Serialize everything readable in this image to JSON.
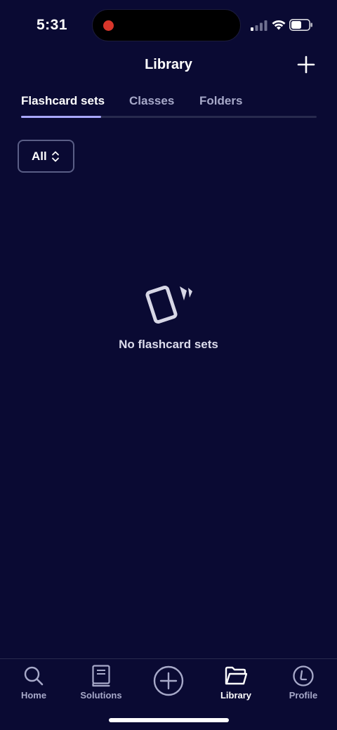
{
  "status_bar": {
    "time": "5:31"
  },
  "header": {
    "title": "Library",
    "add_icon": "plus-icon"
  },
  "tabs": [
    {
      "label": "Flashcard sets",
      "active": true
    },
    {
      "label": "Classes",
      "active": false
    },
    {
      "label": "Folders",
      "active": false
    }
  ],
  "filter": {
    "label": "All",
    "icon": "chevron-updown-icon"
  },
  "empty_state": {
    "icon": "flashcards-icon",
    "text": "No flashcard sets"
  },
  "bottom_nav": [
    {
      "label": "Home",
      "icon": "search-icon",
      "active": false
    },
    {
      "label": "Solutions",
      "icon": "book-icon",
      "active": false
    },
    {
      "label": "",
      "icon": "create-plus-icon",
      "active": false
    },
    {
      "label": "Library",
      "icon": "folder-icon",
      "active": true
    },
    {
      "label": "Profile",
      "icon": "profile-icon",
      "active": false
    }
  ],
  "colors": {
    "background": "#0a0a33",
    "tab_indicator": "#a9a8ff",
    "inactive_text": "#a7a9c9",
    "record_dot": "#d8362b"
  }
}
